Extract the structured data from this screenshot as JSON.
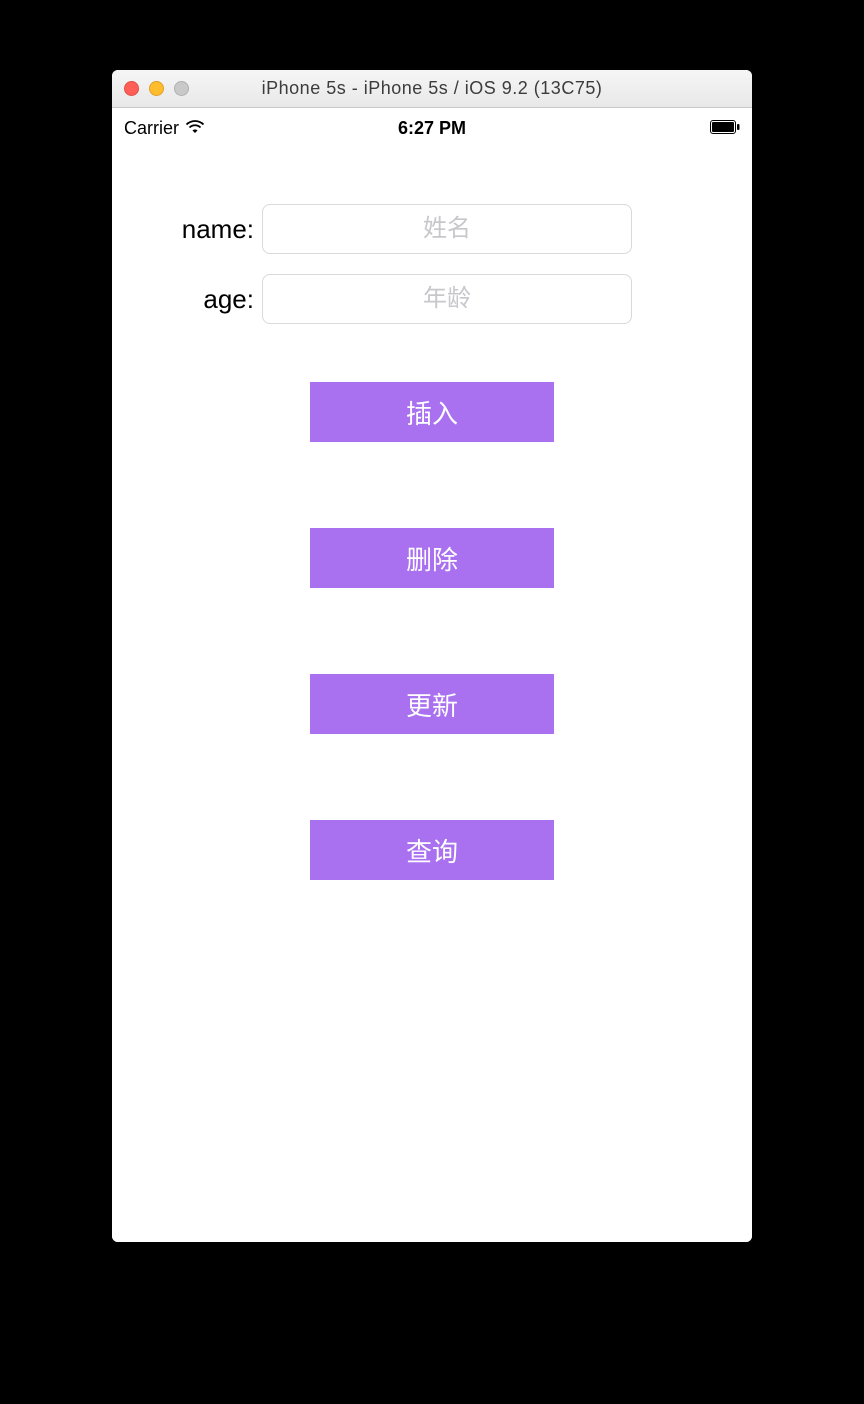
{
  "window": {
    "title": "iPhone 5s - iPhone 5s / iOS 9.2 (13C75)"
  },
  "status_bar": {
    "carrier": "Carrier",
    "time": "6:27 PM"
  },
  "form": {
    "name_label": "name:",
    "name_placeholder": "姓名",
    "name_value": "",
    "age_label": "age:",
    "age_placeholder": "年龄",
    "age_value": ""
  },
  "buttons": {
    "insert": "插入",
    "delete": "删除",
    "update": "更新",
    "query": "查询"
  },
  "colors": {
    "accent": "#a970ef"
  }
}
